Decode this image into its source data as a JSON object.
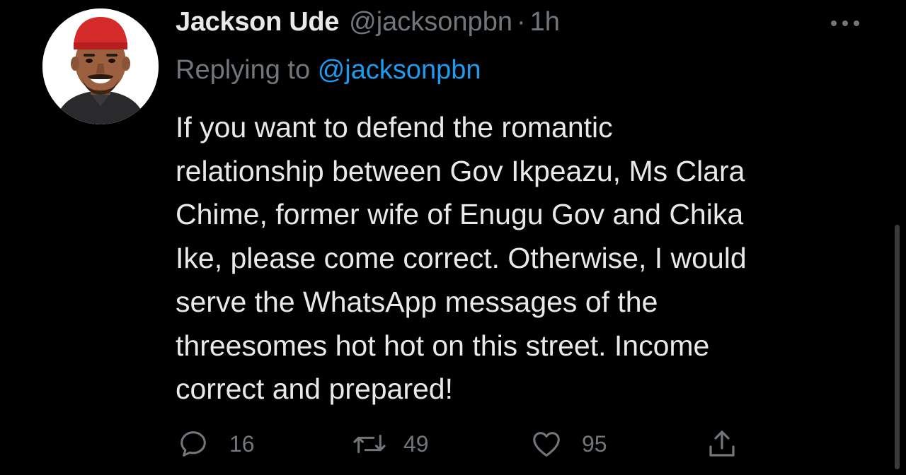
{
  "tweet": {
    "display_name": "Jackson Ude",
    "handle": "@jacksonpbn",
    "separator": "·",
    "time": "1h",
    "replying_prefix": "Replying to",
    "replying_to": "@jacksonpbn",
    "text_lines": [
      "If you want to defend the romantic",
      "relationship between Gov Ikpeazu, Ms Clara",
      "Chime, former wife of Enugu Gov and Chika",
      "Ike, please come correct. Otherwise, I would",
      "serve the WhatsApp messages of the",
      "threesomes hot hot on this street. Income",
      "correct and prepared!"
    ]
  },
  "actions": {
    "reply": {
      "icon": "reply-icon",
      "count": "16"
    },
    "retweet": {
      "icon": "retweet-icon",
      "count": "49"
    },
    "like": {
      "icon": "heart-icon",
      "count": "95"
    },
    "share": {
      "icon": "share-icon"
    }
  },
  "more_icon": "more-options-icon",
  "colors": {
    "background": "#000000",
    "text": "#e7e9ea",
    "secondary": "#71767b",
    "accent": "#1d9bf0"
  }
}
